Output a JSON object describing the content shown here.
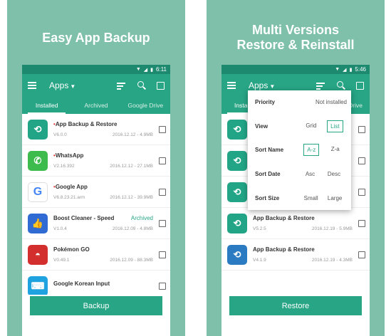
{
  "left_panel": {
    "headline": "Easy App Backup",
    "statusbar": {
      "time": "6:11"
    },
    "toolbar": {
      "title": "Apps"
    },
    "tabs": [
      "Installed",
      "Archived",
      "Google Drive"
    ],
    "apps": [
      {
        "name": "App Backup & Restore",
        "version": "V6.0.0",
        "date": "2016.12.12 - 4.9MB",
        "tag": "",
        "new": true,
        "icon": "backup-icon"
      },
      {
        "name": "WhatsApp",
        "version": "V2.16.392",
        "date": "2016.12.12 - 27.1MB",
        "tag": "",
        "new": true,
        "icon": "whatsapp-icon"
      },
      {
        "name": "Google App",
        "version": "V6.8.23.21.arm",
        "date": "2016.12.12 - 39.9MB",
        "tag": "",
        "new": true,
        "icon": "google-icon"
      },
      {
        "name": "Boost Cleaner - Speed",
        "version": "V1.0.4",
        "date": "2016.12.09 - 4.8MB",
        "tag": "Archived",
        "new": false,
        "icon": "boost-icon"
      },
      {
        "name": "Pokémon GO",
        "version": "V0.49.1",
        "date": "2016.12.09 - 88.3MB",
        "tag": "",
        "new": false,
        "icon": "pokeball-icon"
      },
      {
        "name": "Google Korean Input",
        "version": "",
        "date": "",
        "tag": "",
        "new": false,
        "icon": "keyboard-icon"
      }
    ],
    "action_button": "Backup"
  },
  "right_panel": {
    "headline_line1": "Multi Versions",
    "headline_line2": "Restore & Reinstall",
    "statusbar": {
      "time": "5:46"
    },
    "toolbar": {
      "title": "Apps"
    },
    "tabs_visible": [
      "Insta",
      "Drive"
    ],
    "popup": {
      "priority": {
        "label": "Priority",
        "value": "Not installed"
      },
      "view": {
        "label": "View",
        "options": [
          "Grid",
          "List"
        ],
        "selected": "List"
      },
      "sort_name": {
        "label": "Sort Name",
        "options": [
          "A-z",
          "Z-a"
        ],
        "selected": "A-z"
      },
      "sort_date": {
        "label": "Sort Date",
        "options": [
          "Asc",
          "Desc"
        ],
        "selected": ""
      },
      "sort_size": {
        "label": "Sort Size",
        "options": [
          "Small",
          "Large"
        ],
        "selected": ""
      }
    },
    "apps": [
      {
        "name": "App Backup & Restore",
        "version": "V5.2.5",
        "date": "2016.12.19 - 5.9MB",
        "icon": "backup-icon"
      },
      {
        "name": "App Backup & Restore",
        "version": "V4.1.9",
        "date": "2016.12.19 - 4.3MB",
        "icon": "backup-old-icon"
      }
    ],
    "action_button": "Restore"
  },
  "colors": {
    "accent": "#27a585",
    "statusbar": "#1d8a70",
    "background": "#7ec0aa"
  }
}
